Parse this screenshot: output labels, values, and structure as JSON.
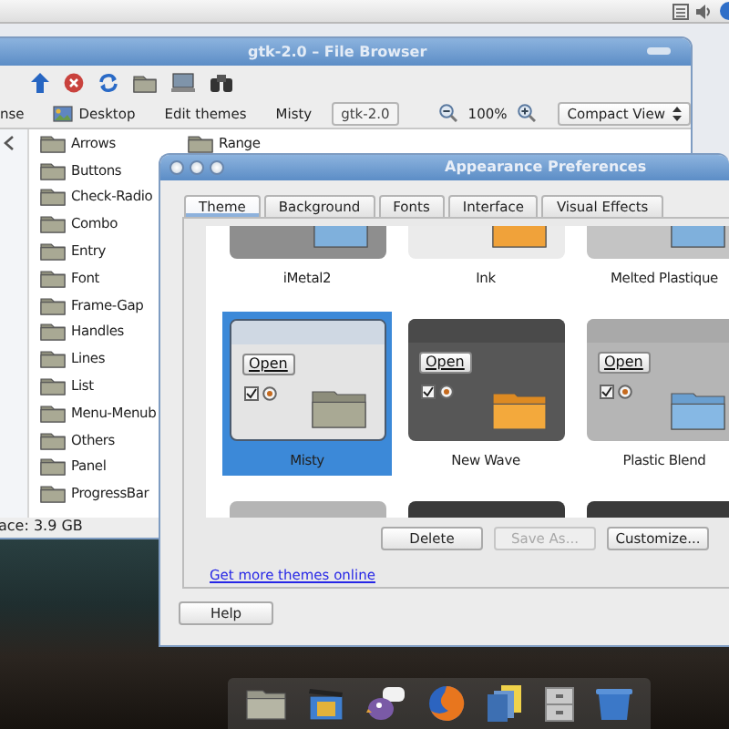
{
  "file_browser": {
    "title": "gtk-2.0 – File Browser",
    "location": [
      {
        "label": "nse",
        "kind": "text",
        "selected": false
      },
      {
        "label": "Desktop",
        "kind": "desktop",
        "selected": false
      },
      {
        "label": "Edit themes",
        "kind": "text",
        "selected": false
      },
      {
        "label": "Misty",
        "kind": "text",
        "selected": false
      },
      {
        "label": "gtk-2.0",
        "kind": "text",
        "selected": true
      }
    ],
    "zoom": "100%",
    "view": "Compact View",
    "files": [
      "Arrows",
      "Buttons",
      "Check-Radio",
      "Combo",
      "Entry",
      "Font",
      "Frame-Gap",
      "Handles",
      "Lines",
      "List",
      "Menu-Menub",
      "Others",
      "Panel",
      "ProgressBar",
      "Range"
    ],
    "status": "ace: 3.9 GB"
  },
  "appearance": {
    "title": "Appearance Preferences",
    "tabs": [
      {
        "label": "Theme",
        "selected": true
      },
      {
        "label": "Background",
        "selected": false
      },
      {
        "label": "Fonts",
        "selected": false
      },
      {
        "label": "Interface",
        "selected": false
      },
      {
        "label": "Visual Effects",
        "selected": false
      }
    ],
    "themes": [
      {
        "name": "iMetal2",
        "kind": "metal",
        "selected": false
      },
      {
        "name": "Ink",
        "kind": "ink",
        "selected": false
      },
      {
        "name": "Melted Plastique",
        "kind": "melted",
        "selected": false
      },
      {
        "name": "Misty",
        "kind": "misty",
        "selected": true,
        "button": "Open"
      },
      {
        "name": "New Wave",
        "kind": "newwave",
        "selected": false,
        "button": "Open"
      },
      {
        "name": "Plastic Blend",
        "kind": "plastic",
        "selected": false,
        "button": "Open"
      },
      {
        "kind": "plastic",
        "selected": false
      },
      {
        "kind": "dark",
        "selected": false
      },
      {
        "kind": "dark",
        "selected": false
      }
    ],
    "actions": [
      {
        "label": "Delete",
        "disabled": false
      },
      {
        "label": "Save As...",
        "disabled": true
      },
      {
        "label": "Customize...",
        "disabled": false
      }
    ],
    "link": "Get more themes online",
    "help": "Help"
  }
}
